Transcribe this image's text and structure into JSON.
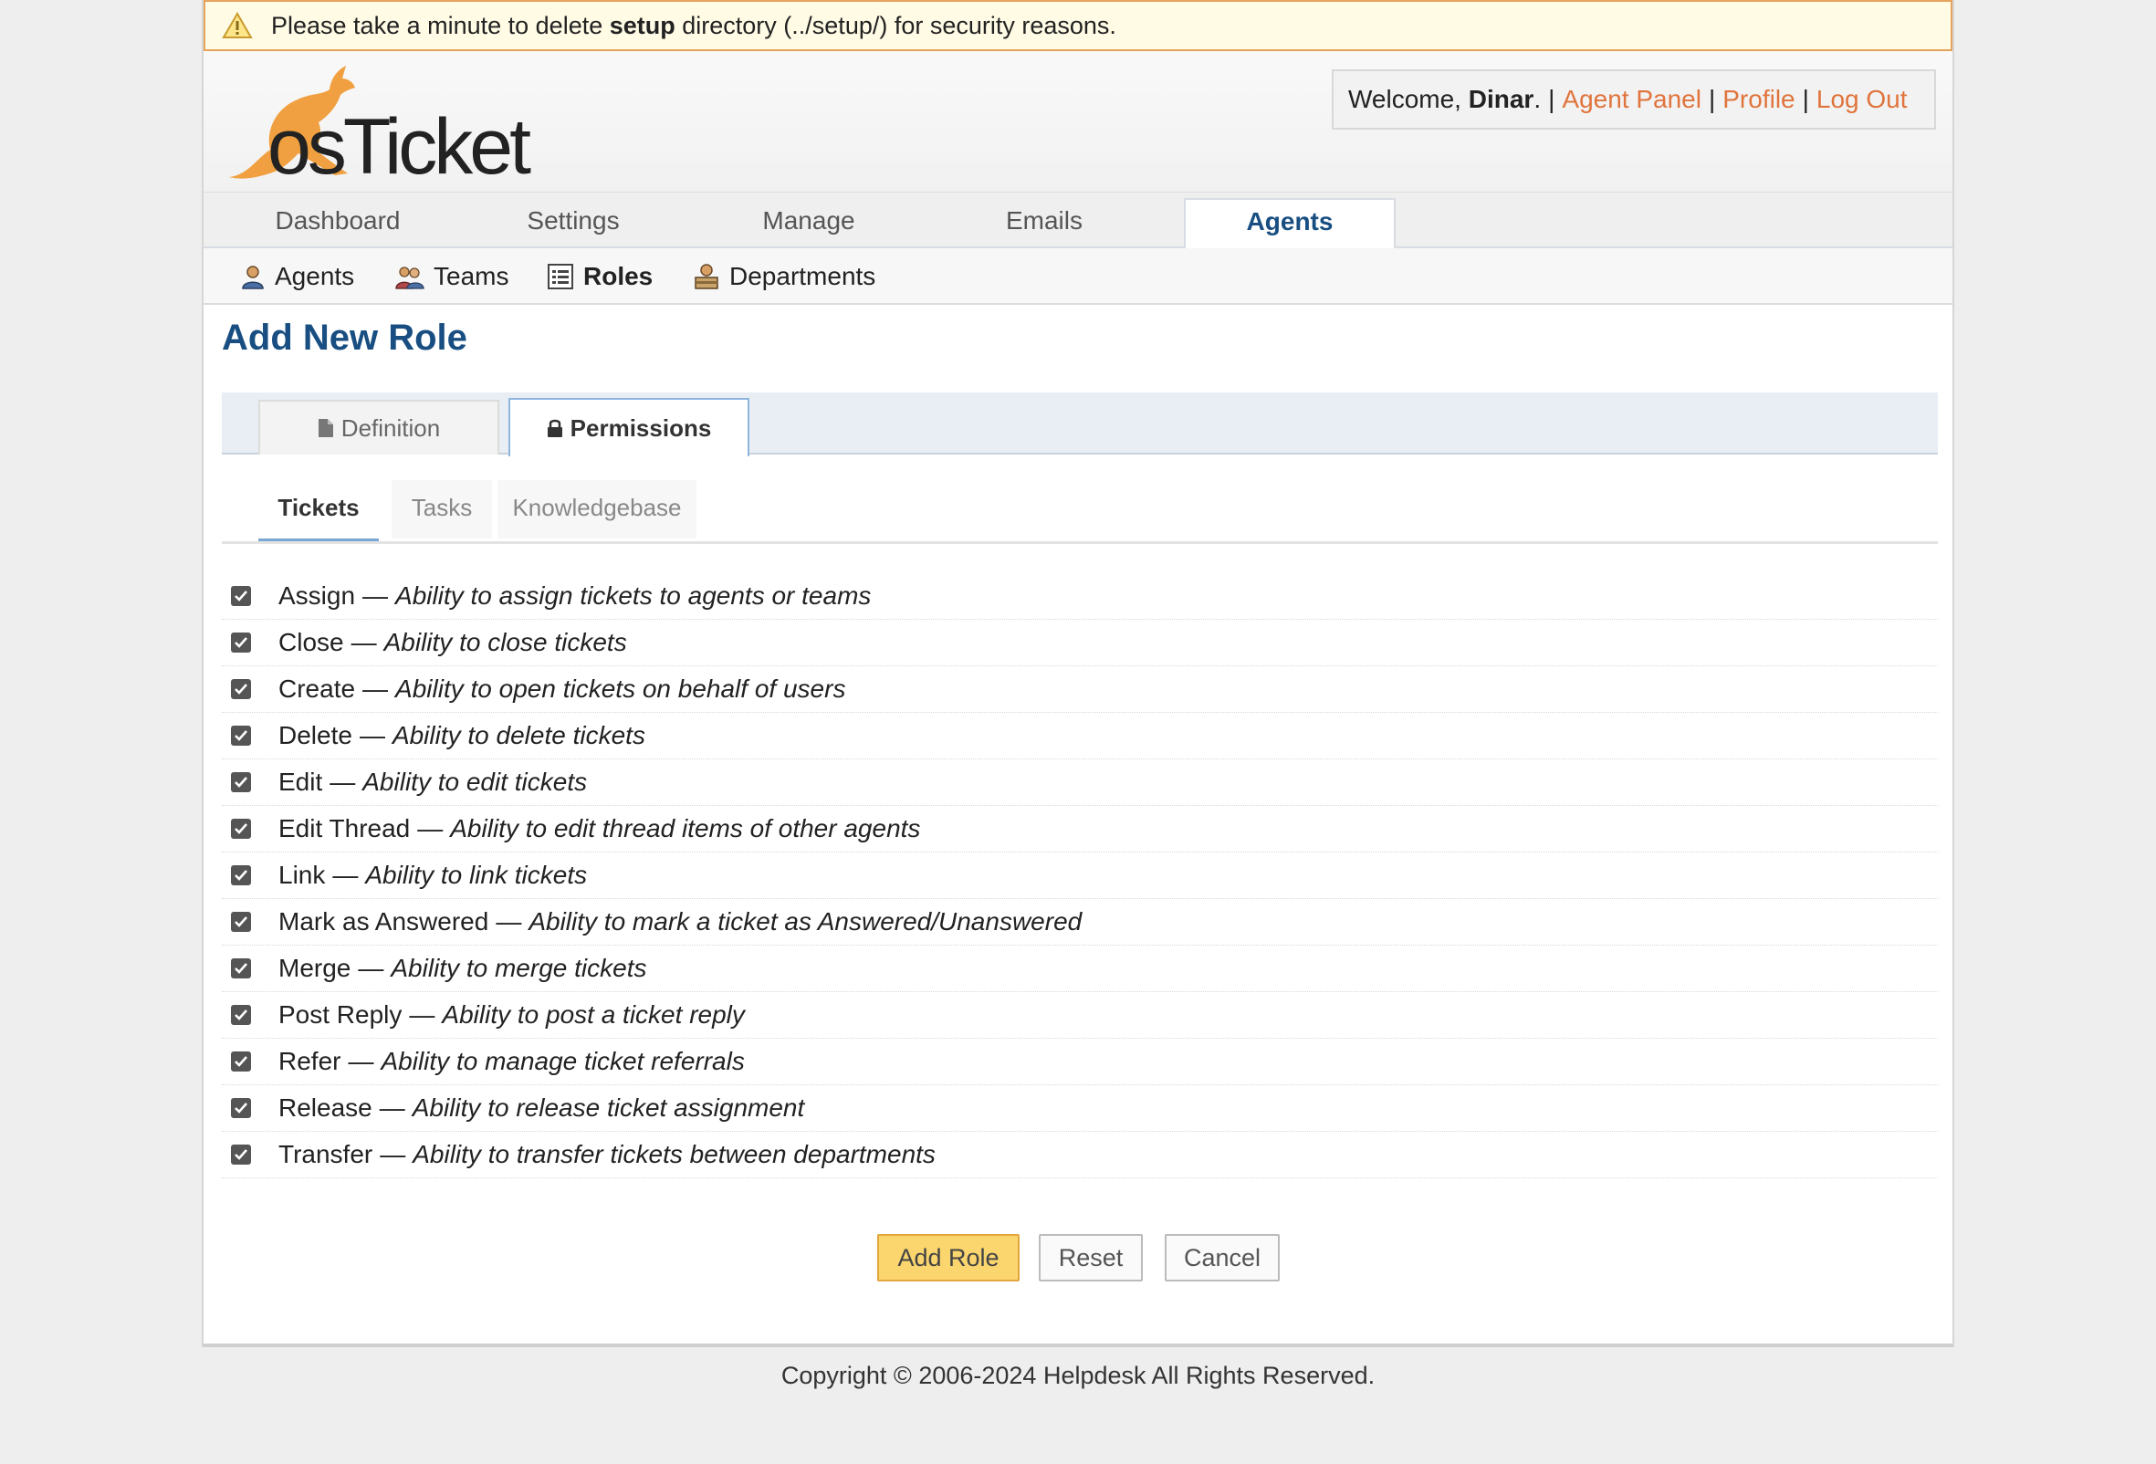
{
  "notice": {
    "prefix": "Please take a minute to delete ",
    "bold": "setup",
    "suffix": " directory (../setup/) for security reasons."
  },
  "logo": {
    "text": "osTicket"
  },
  "user": {
    "welcome_prefix": "Welcome, ",
    "name": "Dinar",
    "welcome_suffix": ".",
    "links": [
      "Agent Panel",
      "Profile",
      "Log Out"
    ],
    "separator": "|"
  },
  "nav": {
    "tabs": [
      "Dashboard",
      "Settings",
      "Manage",
      "Emails",
      "Agents"
    ],
    "active": "Agents"
  },
  "subnav": {
    "items": [
      "Agents",
      "Teams",
      "Roles",
      "Departments"
    ],
    "active": "Roles"
  },
  "page": {
    "title": "Add New Role"
  },
  "tabs": {
    "definition": "Definition",
    "permissions": "Permissions",
    "active": "Permissions"
  },
  "subtabs": {
    "items": [
      "Tickets",
      "Tasks",
      "Knowledgebase"
    ],
    "active": "Tickets"
  },
  "permissions": [
    {
      "name": "Assign",
      "desc": "Ability to assign tickets to agents or teams",
      "checked": true
    },
    {
      "name": "Close",
      "desc": "Ability to close tickets",
      "checked": true
    },
    {
      "name": "Create",
      "desc": "Ability to open tickets on behalf of users",
      "checked": true
    },
    {
      "name": "Delete",
      "desc": "Ability to delete tickets",
      "checked": true
    },
    {
      "name": "Edit",
      "desc": "Ability to edit tickets",
      "checked": true
    },
    {
      "name": "Edit Thread",
      "desc": "Ability to edit thread items of other agents",
      "checked": true
    },
    {
      "name": "Link",
      "desc": "Ability to link tickets",
      "checked": true
    },
    {
      "name": "Mark as Answered",
      "desc": "Ability to mark a ticket as Answered/Unanswered",
      "checked": true
    },
    {
      "name": "Merge",
      "desc": "Ability to merge tickets",
      "checked": true
    },
    {
      "name": "Post Reply",
      "desc": "Ability to post a ticket reply",
      "checked": true
    },
    {
      "name": "Refer",
      "desc": "Ability to manage ticket referrals",
      "checked": true
    },
    {
      "name": "Release",
      "desc": "Ability to release ticket assignment",
      "checked": true
    },
    {
      "name": "Transfer",
      "desc": "Ability to transfer tickets between departments",
      "checked": true
    }
  ],
  "dash": "—",
  "buttons": {
    "add": "Add Role",
    "reset": "Reset",
    "cancel": "Cancel"
  },
  "footer": {
    "text": "Copyright © 2006-2024 Helpdesk All Rights Reserved."
  },
  "colors": {
    "accent": "#184e81",
    "link": "#e0743c",
    "primary_button": "#fbd66e",
    "notice_border": "#e7a25b"
  },
  "icons": {
    "notice": "warning-icon",
    "agents": "agent-icon",
    "teams": "team-icon",
    "roles": "list-icon",
    "departments": "department-icon",
    "definition": "file-icon",
    "permissions": "lock-icon",
    "checkbox": "check-icon"
  }
}
